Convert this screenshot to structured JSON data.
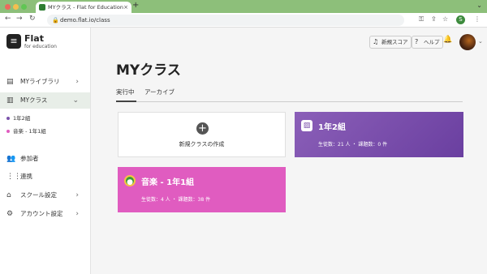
{
  "browser": {
    "tab_title": "MYクラス - Flat for Education",
    "tab_close": "×",
    "new_tab": "+",
    "url": "demo.flat.io/class",
    "profile_letter": "S",
    "nav": {
      "back": "←",
      "forward": "→",
      "reload": "↻"
    }
  },
  "sidebar": {
    "brand": "Flat",
    "brand_sub": "for education",
    "logo_glyph": "≡",
    "items": [
      {
        "label": "MYライブラリ",
        "icon": "library-icon",
        "glyph": "▤",
        "chev": "›"
      },
      {
        "label": "MYクラス",
        "icon": "class-icon",
        "glyph": "▥",
        "chev": "⌄"
      },
      {
        "label": "参加者",
        "icon": "people-icon",
        "glyph": "👥"
      },
      {
        "label": "連携",
        "icon": "integrations-icon",
        "glyph": "⋮⋮"
      },
      {
        "label": "スクール設定",
        "icon": "school-icon",
        "glyph": "⌂",
        "chev": "›"
      },
      {
        "label": "アカウント設定",
        "icon": "gear-icon",
        "glyph": "⚙",
        "chev": "›"
      }
    ],
    "subitems": [
      {
        "label": "1年2組",
        "color": "#7b52ab"
      },
      {
        "label": "音楽 - 1年1組",
        "color": "#e05cc0"
      }
    ]
  },
  "header": {
    "new_score": "新規スコア",
    "help": "ヘルプ",
    "new_score_glyph": "♫",
    "help_glyph": "?",
    "bell_glyph": "🔔",
    "avatar_chev": "⌄"
  },
  "main": {
    "title": "MYクラス",
    "tabs": [
      {
        "label": "実行中",
        "active": true
      },
      {
        "label": "アーカイブ",
        "active": false
      }
    ],
    "new_class": {
      "label": "新規クラスの作成",
      "glyph": "+"
    },
    "classes": [
      {
        "name": "1年2組",
        "stats": "生徒数：21 人 ・ 課題数：0 件",
        "color": "#7b52ab",
        "glyph": "▨"
      },
      {
        "name": "音楽 - 1年1組",
        "stats": "生徒数：4 人 ・ 課題数：38 件",
        "color": "#e05cc0",
        "glyph": "●"
      }
    ]
  }
}
